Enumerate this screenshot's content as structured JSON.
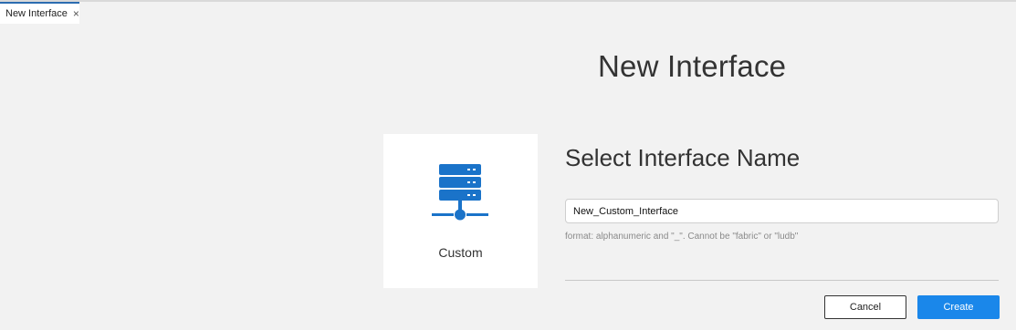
{
  "tab": {
    "label": "New Interface",
    "close_glyph": "×"
  },
  "page": {
    "title": "New Interface"
  },
  "card": {
    "label": "Custom",
    "icon": "server-network-icon",
    "icon_color": "#1a73c9"
  },
  "form": {
    "section_title": "Select Interface Name",
    "name_value": "New_Custom_Interface",
    "hint": "format: alphanumeric and \"_\". Cannot be \"fabric\" or \"ludb\""
  },
  "actions": {
    "cancel_label": "Cancel",
    "create_label": "Create",
    "create_color": "#1a87ea"
  }
}
